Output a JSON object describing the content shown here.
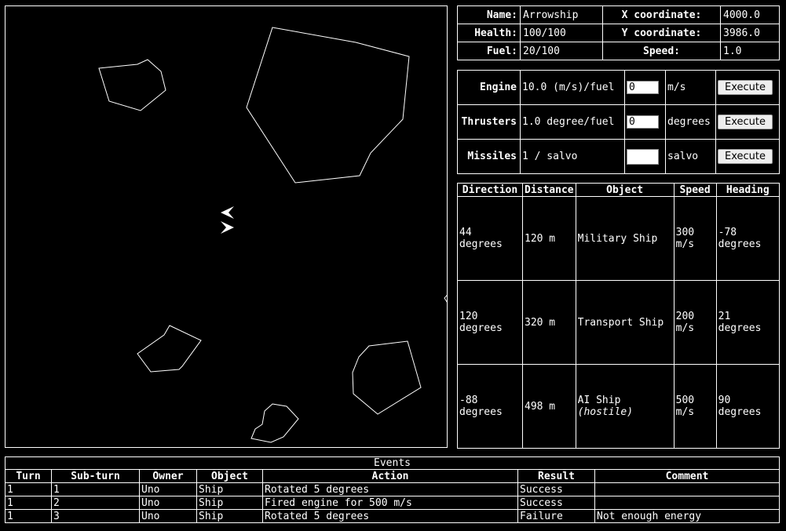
{
  "status": {
    "name_label": "Name:",
    "name_value": "Arrowship",
    "x_label": "X coordinate:",
    "x_value": "4000.0",
    "health_label": "Health:",
    "health_value": "100/100",
    "y_label": "Y coordinate:",
    "y_value": "3986.0",
    "fuel_label": "Fuel:",
    "fuel_value": "20/100",
    "speed_label": "Speed:",
    "speed_value": "1.0"
  },
  "controls": {
    "engine": {
      "label": "Engine",
      "rate": "10.0 (m/s)/fuel",
      "value": "0",
      "unit": "m/s",
      "button": "Execute"
    },
    "thrusters": {
      "label": "Thrusters",
      "rate": "1.0 degree/fuel",
      "value": "0",
      "unit": "degrees",
      "button": "Execute"
    },
    "missiles": {
      "label": "Missiles",
      "rate": "1 / salvo",
      "value": "",
      "unit": "salvo",
      "button": "Execute"
    }
  },
  "radar": {
    "headers": [
      "Direction",
      "Distance",
      "Object",
      "Speed",
      "Heading"
    ],
    "rows": [
      {
        "direction": "44 degrees",
        "distance": "120 m",
        "object": "Military Ship",
        "note": "",
        "speed": "300 m/s",
        "heading": "-78 degrees"
      },
      {
        "direction": "120 degrees",
        "distance": "320 m",
        "object": "Transport Ship",
        "note": "",
        "speed": "200 m/s",
        "heading": "21 degrees"
      },
      {
        "direction": "-88 degrees",
        "distance": "498 m",
        "object": "AI Ship",
        "note": "(hostile)",
        "speed": "500 m/s",
        "heading": "90 degrees"
      }
    ]
  },
  "events": {
    "caption": "Events",
    "headers": [
      "Turn",
      "Sub-turn",
      "Owner",
      "Object",
      "Action",
      "Result",
      "Comment"
    ],
    "rows": [
      [
        "1",
        "1",
        "Uno",
        "Ship",
        "Rotated 5 degrees",
        "Success",
        ""
      ],
      [
        "1",
        "2",
        "Uno",
        "Ship",
        "Fired engine for 500 m/s",
        "Success",
        ""
      ],
      [
        "1",
        "3",
        "Uno",
        "Ship",
        "Rotated 5 degrees",
        "Failure",
        "Not enough energy"
      ]
    ]
  }
}
